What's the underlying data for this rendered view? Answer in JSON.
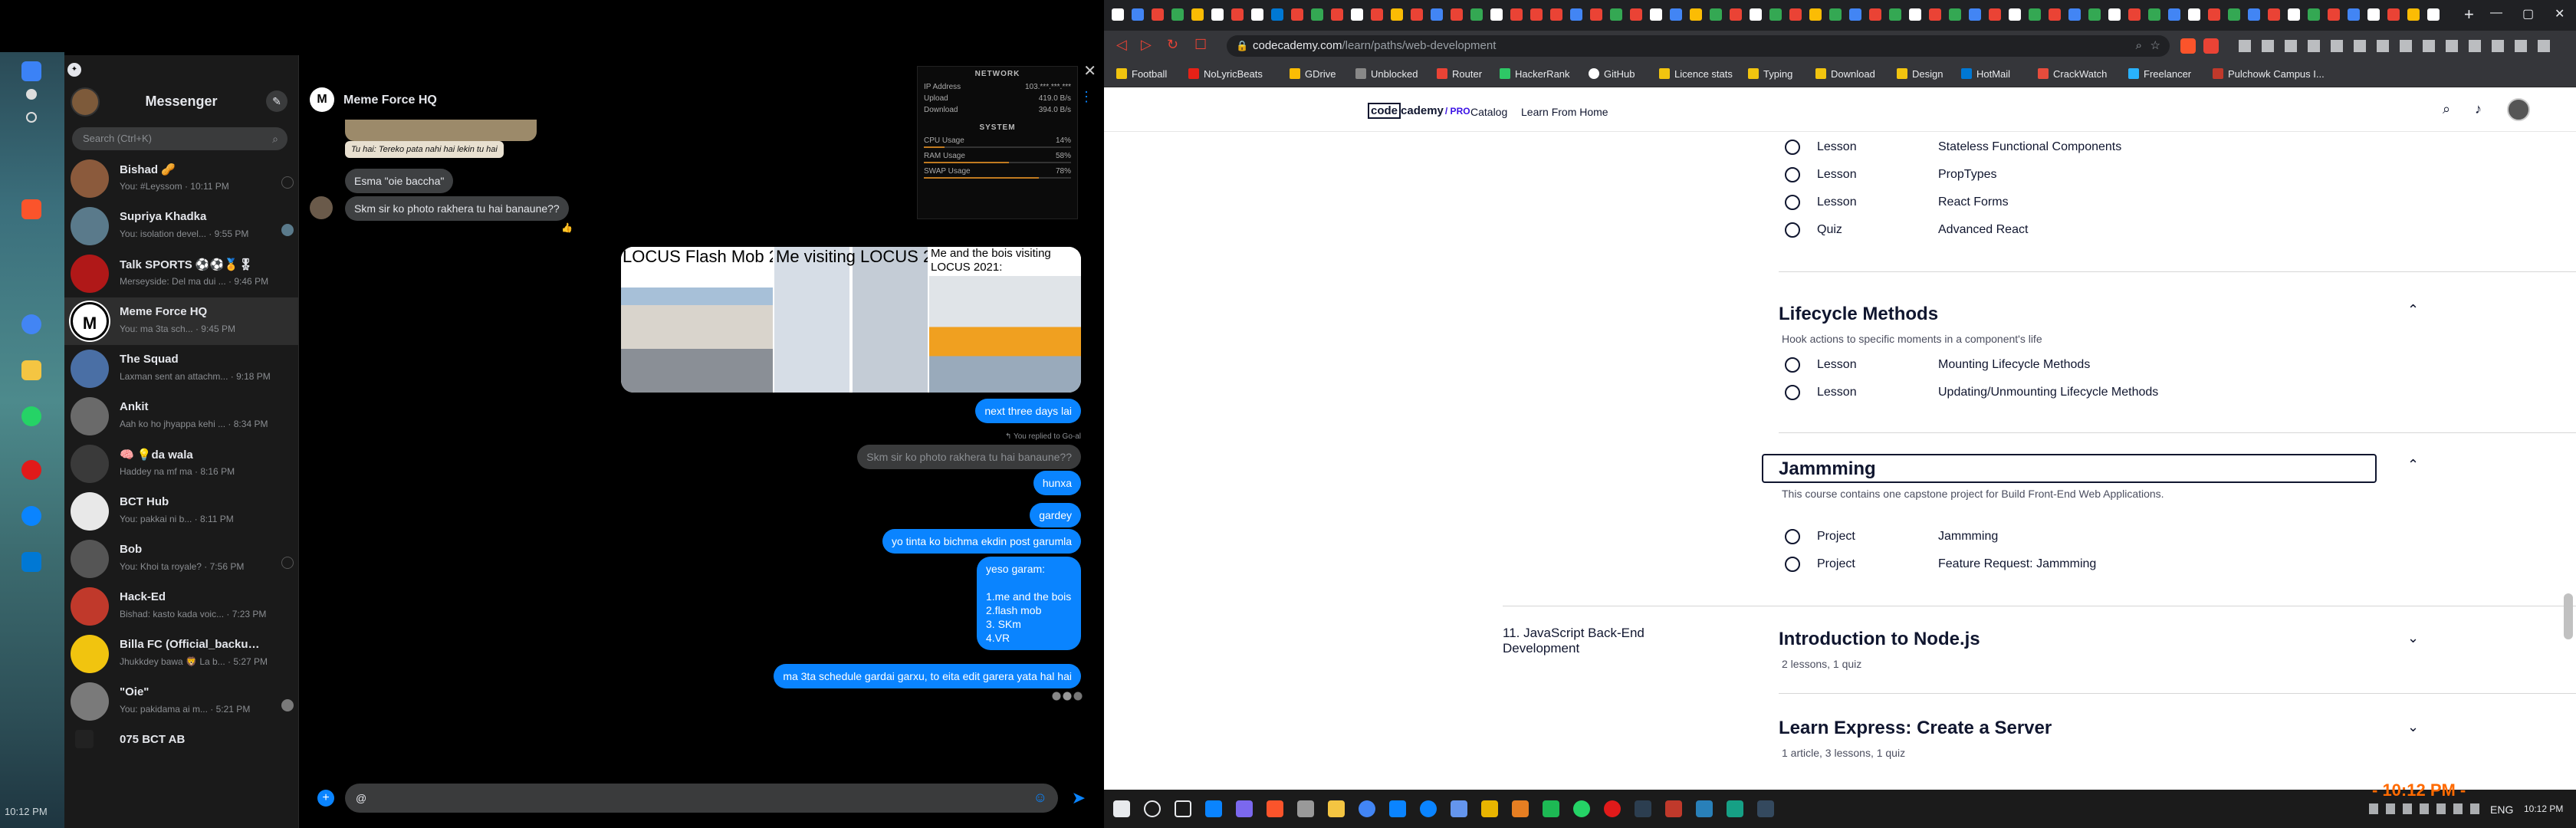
{
  "messenger": {
    "title": "Messenger",
    "search_placeholder": "Search (Ctrl+K)",
    "conversations": [
      {
        "name": "Bishad 🥜",
        "preview": "You: #Leyssom · 10:11 PM",
        "color": "#8b5a3c"
      },
      {
        "name": "Supriya Khadka",
        "preview": "You: isolation devel... · 9:55 PM",
        "color": "#5a7a8b"
      },
      {
        "name": "Talk SPORTS ⚽⚽🏅🎖",
        "preview": "Merseyside: Del ma dui ... · 9:46 PM",
        "color": "#b01818"
      },
      {
        "name": "Meme Force HQ",
        "preview": "You: ma 3ta sch... · 9:45 PM",
        "color": "#ffffff"
      },
      {
        "name": "The Squad",
        "preview": "Laxman sent an attachm... · 9:18 PM",
        "color": "#4a6fa5"
      },
      {
        "name": "Ankit",
        "preview": "Aah ko ho jhyappa kehi ... · 8:34 PM",
        "color": "#6a6a6a"
      },
      {
        "name": "🧠 💡da wala",
        "preview": "Haddey na mf ma · 8:16 PM",
        "color": "#3a3a3a"
      },
      {
        "name": "BCT Hub",
        "preview": "You: pakkai ni b... · 8:11 PM",
        "color": "#e8e8e8"
      },
      {
        "name": "Bob",
        "preview": "You: Khoi ta royale? · 7:56 PM",
        "color": "#555555"
      },
      {
        "name": "Hack-Ed",
        "preview": "Bishad: kasto kada voic... · 7:23 PM",
        "color": "#c0392b"
      },
      {
        "name": "Billa FC (Official_backup_play...",
        "preview": "Jhukkdey bawa 🦁 La b... · 5:27 PM",
        "color": "#f1c40f"
      },
      {
        "name": "\"Oie\"",
        "preview": "You: pakidama ai m... · 5:21 PM",
        "color": "#7a7a7a"
      },
      {
        "name": "075 BCT AB",
        "preview": "",
        "color": "#222222"
      }
    ]
  },
  "chat": {
    "title": "Meme Force HQ",
    "incoming": [
      {
        "text": "Tu hai: Tereko pata nahi hai lekin tu hai"
      },
      {
        "text": "Esma \"oie baccha\""
      },
      {
        "text": "Skm sir ko photo rakhera tu hai banaune??"
      }
    ],
    "image_captions": [
      "LOCUS Flash Mob 2021",
      "Me visiting LOCUS 2021:",
      "Me and the bois visiting LOCUS 2021:"
    ],
    "reply_note": "↰ You replied to Go-al",
    "replied_text": "Skm sir ko photo rakhera tu hai banaune??",
    "outgoing": [
      {
        "text": "next three days lai"
      },
      {
        "text": "hunxa"
      },
      {
        "text": "gardey"
      },
      {
        "text": "yo tinta ko bichma ekdin post garumla"
      },
      {
        "text": "ma 3ta schedule gardai garxu, to eita edit garera yata hal hai"
      }
    ],
    "list_msg": {
      "intro": "yeso garam:",
      "items": [
        "1.me and the bois",
        "2.flash mob",
        "3. SKm",
        "4.VR"
      ]
    },
    "composer_value": "@"
  },
  "system_widget": {
    "network_label": "NETWORK",
    "ip_label": "IP Address",
    "ip_value": "103.***.***.***",
    "upload_label": "Upload",
    "upload_value": "419.0 B/s",
    "download_label": "Download",
    "download_value": "394.0 B/s",
    "system_label": "SYSTEM",
    "cpu_label": "CPU Usage",
    "cpu_value": "14%",
    "cpu_fraction": 0.14,
    "ram_label": "RAM Usage",
    "ram_value": "58%",
    "ram_fraction": 0.58,
    "swap_label": "SWAP Usage",
    "swap_value": "78%",
    "swap_fraction": 0.78
  },
  "left_clock": "10:12 PM",
  "browser": {
    "url_host": "codecademy.com",
    "url_path": "/learn/paths/web-development",
    "bookmarks": [
      {
        "label": "Football",
        "color": "#f1c40f"
      },
      {
        "label": "NoLyricBeats",
        "color": "#e62117"
      },
      {
        "label": "GDrive",
        "color": "#fbbc04"
      },
      {
        "label": "Unblocked",
        "color": "#888888"
      },
      {
        "label": "Router",
        "color": "#ea4335"
      },
      {
        "label": "HackerRank",
        "color": "#2ec866"
      },
      {
        "label": "GitHub",
        "color": "#ffffff"
      },
      {
        "label": "Licence stats",
        "color": "#f1c40f"
      },
      {
        "label": "Typing",
        "color": "#f1c40f"
      },
      {
        "label": "Download",
        "color": "#f1c40f"
      },
      {
        "label": "Design",
        "color": "#f1c40f"
      },
      {
        "label": "HotMail",
        "color": "#0078d4"
      },
      {
        "label": "CrackWatch",
        "color": "#e74c3c"
      },
      {
        "label": "Freelancer",
        "color": "#29b2fe"
      },
      {
        "label": "Pulchowk Campus I...",
        "color": "#c0392b"
      }
    ]
  },
  "codecademy": {
    "logo_code": "code",
    "logo_rest": "cademy",
    "logo_pro": "/ PRO",
    "nav_catalog": "Catalog",
    "nav_learn": "Learn From Home",
    "react_items": [
      {
        "type": "Lesson",
        "title": "Stateless Functional Components"
      },
      {
        "type": "Lesson",
        "title": "PropTypes"
      },
      {
        "type": "Lesson",
        "title": "React Forms"
      },
      {
        "type": "Quiz",
        "title": "Advanced React"
      }
    ],
    "lifecycle": {
      "title": "Lifecycle Methods",
      "desc": "Hook actions to specific moments in a component's life",
      "items": [
        {
          "type": "Lesson",
          "title": "Mounting Lifecycle Methods"
        },
        {
          "type": "Lesson",
          "title": "Updating/Unmounting Lifecycle Methods"
        }
      ]
    },
    "jamming": {
      "title": "Jammming",
      "desc": "This course contains one capstone project for Build Front-End Web Applications.",
      "items": [
        {
          "type": "Project",
          "title": "Jammming"
        },
        {
          "type": "Project",
          "title": "Feature Request: Jammming"
        }
      ]
    },
    "section_11": "11. JavaScript Back-End Development",
    "node": {
      "title": "Introduction to Node.js",
      "meta": "2 lessons, 1 quiz"
    },
    "express": {
      "title": "Learn Express: Create a Server",
      "meta": "1 article, 3 lessons, 1 quiz"
    }
  },
  "taskbar": {
    "lang": "ENG",
    "time": "10:12 PM",
    "overlay_time": "- 10:12 PM -"
  }
}
